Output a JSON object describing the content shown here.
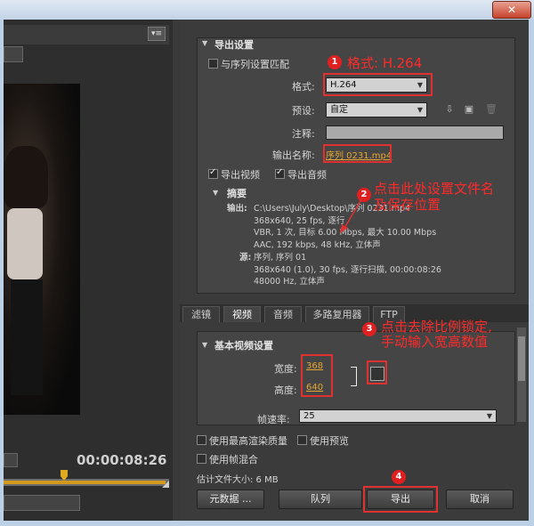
{
  "export_settings": {
    "title": "导出设置",
    "match_sequence_label": "与序列设置匹配",
    "format_label": "格式:",
    "format_value": "H.264",
    "preset_label": "预设:",
    "preset_value": "自定",
    "comment_label": "注释:",
    "output_name_label": "输出名称:",
    "output_name_value": "序列 0231.mp4",
    "export_video_label": "导出视频",
    "export_audio_label": "导出音频"
  },
  "summary": {
    "title": "摘要",
    "output_label": "输出:",
    "output_text": "C:\\Users\\July\\Desktop\\序列 0231.mp4\n368x640, 25 fps, 逐行\nVBR, 1 次, 目标 6.00 Mbps, 最大 10.00 Mbps\nAAC, 192 kbps, 48 kHz, 立体声",
    "source_label": "源:",
    "source_text": "序列, 序列 01\n368x640 (1.0), 30 fps, 逐行扫描, 00:00:08:26\n48000 Hz, 立体声"
  },
  "tabs": [
    "滤镜",
    "视频",
    "音频",
    "多路复用器",
    "FTP"
  ],
  "basic_video": {
    "title": "基本视频设置",
    "width_label": "宽度:",
    "width_value": "368",
    "height_label": "高度:",
    "height_value": "640",
    "frame_rate_label": "帧速率:",
    "frame_rate_value": "25"
  },
  "options": {
    "max_render_quality": "使用最高渲染质量",
    "use_previews": "使用预览",
    "frame_blending": "使用帧混合",
    "estimated_size": "估计文件大小: 6 MB"
  },
  "buttons": {
    "metadata": "元数据 ...",
    "queue": "队列",
    "export": "导出",
    "cancel": "取消"
  },
  "annotations": {
    "n1": "1",
    "note1": "格式: H.264",
    "n2": "2",
    "note2_line1": "点击此处设置文件名",
    "note2_line2": "及保存位置",
    "n3": "3",
    "note3_line1": "点击去除比例锁定,",
    "note3_line2": "手动输入宽高数值",
    "n4": "4"
  },
  "timeline": {
    "timecode": "00:00:08:26",
    "progress": 0.35
  },
  "window": {
    "close_glyph": "✕",
    "panel_menu_glyph": "▾≡"
  },
  "colors": {
    "annotation": "#e03030",
    "accent": "#e8a632"
  }
}
